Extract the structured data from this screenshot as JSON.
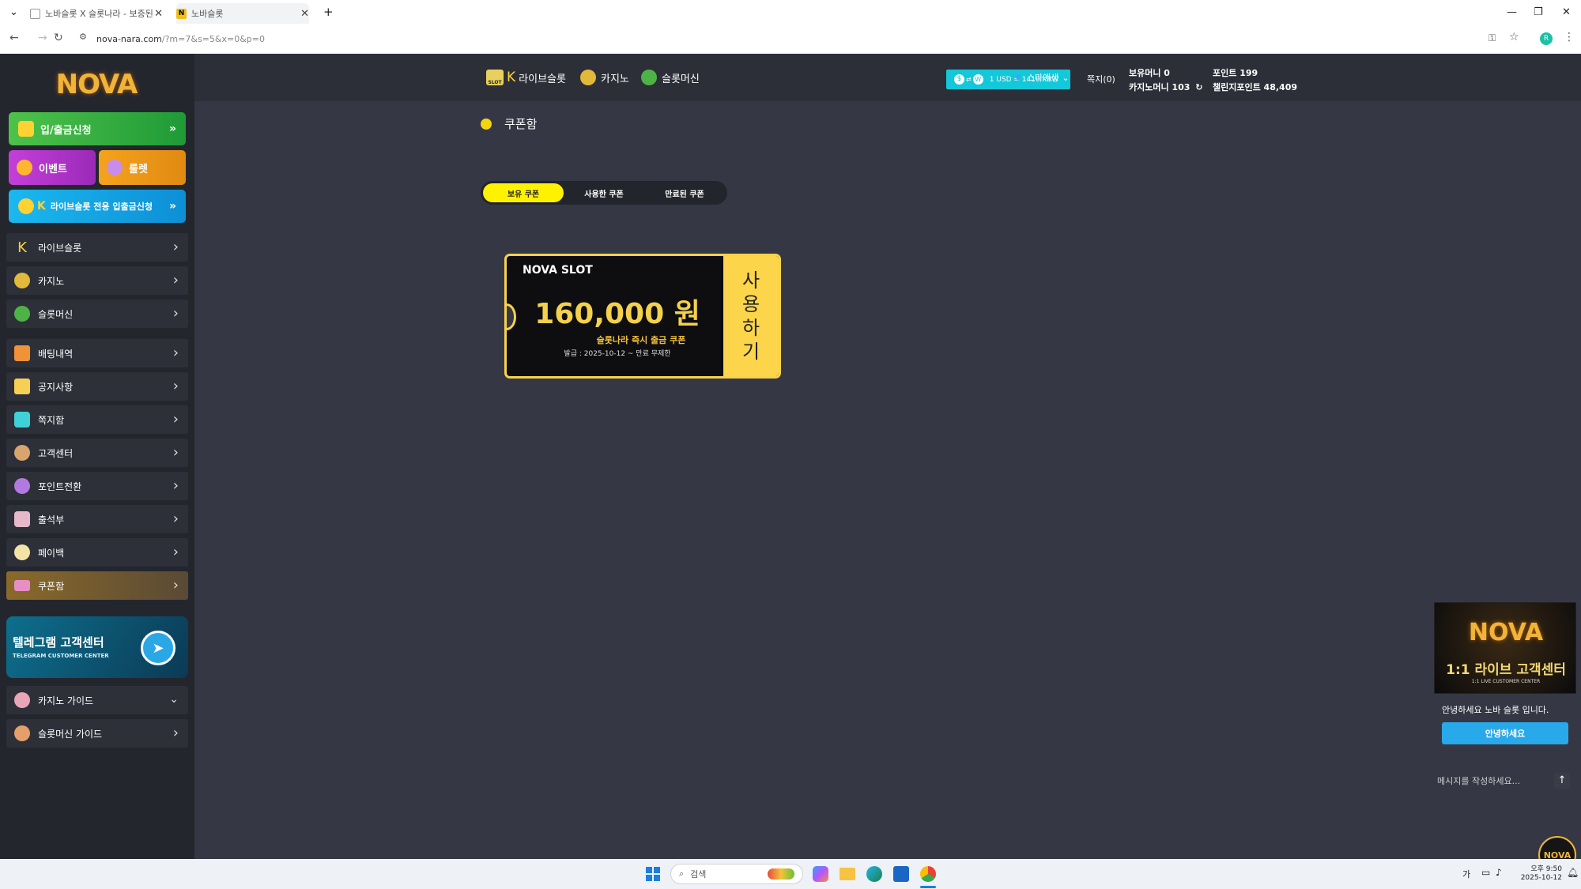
{
  "browser": {
    "tabs": [
      {
        "label": "노바슬롯 X 슬롯나라 - 보증된",
        "icon": "page-icon"
      },
      {
        "label": "노바슬롯",
        "icon": "n-logo-icon"
      }
    ],
    "new_tab": "+",
    "url_host": "nova-nara.com",
    "url_path": "/?m=7&s=5&x=0&p=0",
    "profile_initial": "R"
  },
  "site": {
    "logo": "NOVA",
    "sidebar": {
      "deposit_btn": "입/출금신청",
      "event_btn": "이벤트",
      "roulette_btn": "룰렛",
      "liveslot_btn": "라이브슬롯 전용 입출금신청",
      "menu": [
        {
          "label": "라이브슬롯"
        },
        {
          "label": "카지노"
        },
        {
          "label": "슬롯머신"
        },
        {
          "label": "배팅내역"
        },
        {
          "label": "공지사항"
        },
        {
          "label": "쪽지함"
        },
        {
          "label": "고객센터"
        },
        {
          "label": "포인트전환"
        },
        {
          "label": "출석부"
        },
        {
          "label": "페이백"
        },
        {
          "label": "쿠폰함"
        }
      ],
      "telegram_title": "텔레그램 고객센터",
      "telegram_sub": "TELEGRAM CUSTOMER CENTER",
      "guides": [
        {
          "label": "카지노 가이드"
        },
        {
          "label": "슬롯머신 가이드"
        }
      ]
    },
    "topnav": {
      "slot_badge": "SLOT",
      "items": [
        "라이브슬롯",
        "카지노",
        "슬롯머신"
      ],
      "rate": "1 USD = 1410 KRW",
      "username": "스마애생",
      "messages": "쪽지(0)",
      "balance_label": "보유머니 0",
      "casino_label": "카지노머니 103",
      "points_label": "포인트 199",
      "challenge_label": "챌린지포인트 48,409"
    },
    "coupon_page": {
      "title": "쿠폰함",
      "tabs": [
        "보유 쿠폰",
        "사용한 쿠폰",
        "만료된 쿠폰"
      ],
      "coupon": {
        "brand": "NOVA SLOT",
        "amount": "160,000 원",
        "name": "슬롯나라 즉시 출금 쿠폰",
        "issued": "발급 : 2025-10-12 ~ 만료 무제한",
        "use_label": [
          "사",
          "용",
          "하",
          "기"
        ]
      }
    },
    "chat": {
      "banner_brand": "NOVA",
      "banner_title": "1:1 라이브 고객센터",
      "banner_sub": "1:1 LIVE CUSTOMER CENTER",
      "greeting": "안녕하세요 노바 슬롯 입니다.",
      "quick_reply": "안녕하세요",
      "placeholder": "메시지를 작성하세요..."
    }
  },
  "taskbar": {
    "search": "검색",
    "ime": "가",
    "time": "오후 9:50",
    "date": "2025-10-12"
  }
}
